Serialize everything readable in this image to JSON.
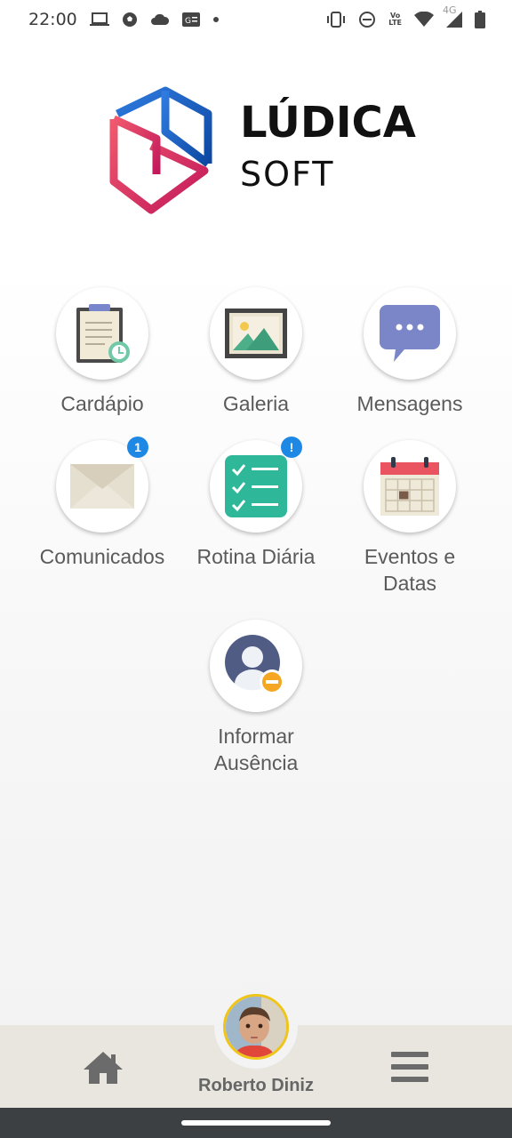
{
  "status_bar": {
    "time": "22:00",
    "left_icons": [
      "laptop-icon",
      "soccer-ball-icon",
      "cloud-icon",
      "google-news-icon",
      "dot-icon"
    ],
    "right_icons": [
      "vibrate-icon",
      "do-not-disturb-icon",
      "volte-icon",
      "wifi-icon",
      "signal-icon",
      "battery-icon"
    ],
    "volte_top": "Vo",
    "volte_bottom": "LTE",
    "network": "4G"
  },
  "brand": {
    "name_line1": "LÚDICA",
    "name_line2": "SOFT",
    "colors": {
      "blue": "#1565c0",
      "red": "#e53950"
    }
  },
  "menu": {
    "cardapio": {
      "label": "Cardápio",
      "icon": "clipboard-clock-icon"
    },
    "galeria": {
      "label": "Galeria",
      "icon": "picture-icon"
    },
    "mensagens": {
      "label": "Mensagens",
      "icon": "chat-bubble-icon"
    },
    "comunicados": {
      "label": "Comunicados",
      "icon": "envelope-icon",
      "badge": "1"
    },
    "rotina": {
      "label": "Rotina Diária",
      "icon": "checklist-icon",
      "badge": "!"
    },
    "eventos": {
      "label_line1": "Eventos e",
      "label_line2": "Datas",
      "icon": "calendar-icon"
    },
    "ausencia": {
      "label_line1": "Informar",
      "label_line2": "Ausência",
      "icon": "user-minus-icon"
    }
  },
  "bottom_nav": {
    "home_icon": "home-icon",
    "menu_icon": "hamburger-menu-icon",
    "user_name": "Roberto Diniz"
  },
  "colors": {
    "badge": "#1e88e5",
    "nav_bg": "#e8e6de",
    "label": "#5a5a5a"
  }
}
